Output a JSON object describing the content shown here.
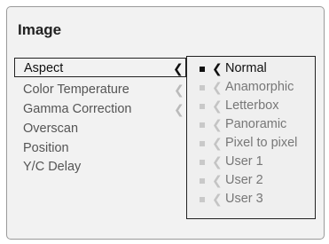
{
  "title": "Image",
  "menu": {
    "items": [
      {
        "label": "Aspect",
        "selected": true,
        "has_submenu": true
      },
      {
        "label": "Color Temperature",
        "selected": false,
        "has_submenu": true
      },
      {
        "label": "Gamma Correction",
        "selected": false,
        "has_submenu": true
      },
      {
        "label": "Overscan",
        "selected": false,
        "has_submenu": false
      },
      {
        "label": "Position",
        "selected": false,
        "has_submenu": false
      },
      {
        "label": "Y/C Delay",
        "selected": false,
        "has_submenu": false
      }
    ]
  },
  "submenu": {
    "items": [
      {
        "label": "Normal",
        "selected": true
      },
      {
        "label": "Anamorphic",
        "selected": false
      },
      {
        "label": "Letterbox",
        "selected": false
      },
      {
        "label": "Panoramic",
        "selected": false
      },
      {
        "label": "Pixel to pixel",
        "selected": false
      },
      {
        "label": "User 1",
        "selected": false
      },
      {
        "label": "User 2",
        "selected": false
      },
      {
        "label": "User 3",
        "selected": false
      }
    ]
  },
  "icons": {
    "submenu_arrow": "chevron-left-icon",
    "option_bullet": "square-bullet-icon"
  },
  "colors": {
    "background": "#f2f2f2",
    "selected_text": "#111111",
    "inactive_text": "#555555",
    "border": "#222222"
  }
}
